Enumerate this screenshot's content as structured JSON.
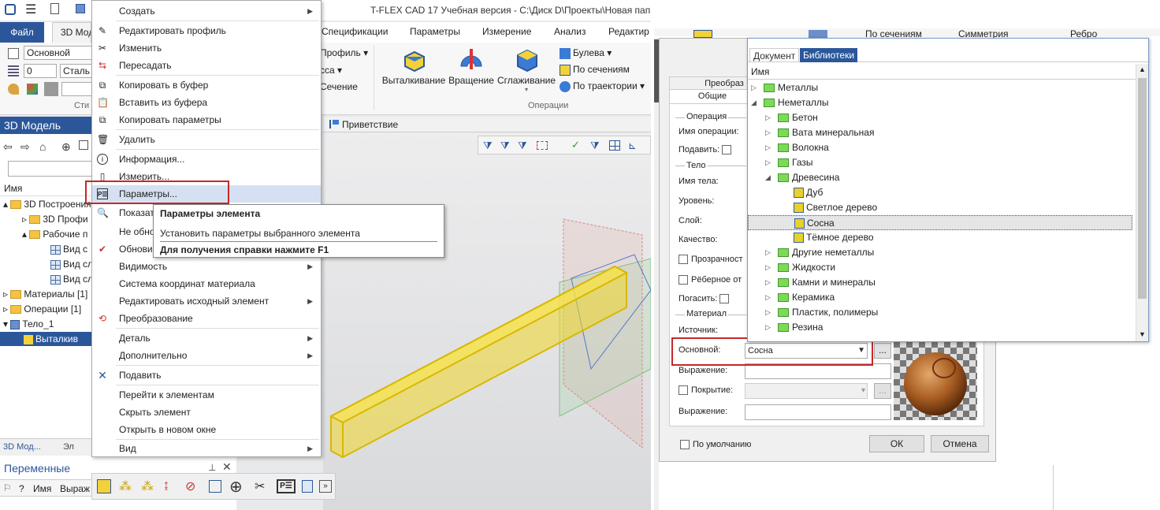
{
  "app": {
    "title": "T-FLEX CAD 17 Учебная версия - C:\\Диск D\\Проекты\\Новая папк",
    "tabs": [
      "Файл",
      "3D Модель",
      "Спецификации",
      "Параметры",
      "Измерение",
      "Анализ",
      "Редактир"
    ],
    "ribbon": {
      "style_combo": "Основной",
      "layer_combo": "0",
      "material_combo": "Сталь",
      "style_group": "Сти",
      "left_buttons": [
        "Профиль",
        "сса",
        "Сечение"
      ],
      "ops": [
        "Выталкивание",
        "Вращение",
        "Сглаживание"
      ],
      "ops_group": "Операции",
      "small_ops": [
        "Булева",
        "По сечениям",
        "По траектории"
      ]
    },
    "panel_title": "3D Модель",
    "tree_header": "Имя",
    "tree": [
      "3D Построения",
      "3D Профи",
      "Рабочие п",
      "Вид с",
      "Вид сл",
      "Вид сл",
      "Материалы [1]",
      "Операции [1]",
      "Тело_1",
      "Выталкив"
    ],
    "viewport_tab": "Приветствие",
    "bottom_tabs": [
      "3D Мод...",
      "Эл"
    ],
    "variables": {
      "title": "Переменные",
      "cols": [
        "?",
        "Имя",
        "Выраж"
      ]
    }
  },
  "context_menu": {
    "items": [
      "Создать",
      "Редактировать профиль",
      "Изменить",
      "Пересадать",
      "Копировать в буфер",
      "Вставить из буфера",
      "Копировать параметры",
      "Удалить",
      "Информация...",
      "Измерить...",
      "Параметры...",
      "Показать",
      "Не обно",
      "Обнови",
      "Видимость",
      "Система координат материала",
      "Редактировать исходный элемент",
      "Преобразование",
      "Деталь",
      "Дополнительно",
      "Подавить",
      "Перейти к элементам",
      "Скрыть элемент",
      "Открыть в новом окне",
      "Вид"
    ]
  },
  "tooltip": {
    "title": "Параметры элемента",
    "line1": "Установить параметры выбранного элемента",
    "line2": "Для получения справки нажмите F1"
  },
  "top_strip": {
    "items": [
      "По сечениям",
      "Симметрия",
      "Ребро"
    ]
  },
  "dialog": {
    "tab_partial": "Преобраз",
    "tab_general": "Общие",
    "section_operation": "Операция",
    "op_name_label": "Имя операции:",
    "suppress_label": "Подавить:",
    "section_body": "Тело",
    "body_name_label": "Имя тела:",
    "level_label": "Уровень:",
    "layer_label": "Слой:",
    "quality_label": "Качество:",
    "transparency_label": "Прозрачност",
    "rib_label": "Рёберное от",
    "hide_label": "Погасить:",
    "section_material": "Материал",
    "source_label": "Источник:",
    "main_label": "Основной:",
    "main_value": "Сосна",
    "expr_label": "Выражение:",
    "coating_label": "Покрытие:",
    "expr2_label": "Выражение:",
    "default_label": "По умолчанию",
    "ok": "ОК",
    "cancel": "Отмена",
    "ellipsis": "..."
  },
  "library": {
    "tabs": [
      "Документ",
      "Библиотеки"
    ],
    "header": "Имя",
    "rows": [
      "Металлы",
      "Неметаллы",
      "Бетон",
      "Вата минеральная",
      "Волокна",
      "Газы",
      "Древесина",
      "Дуб",
      "Светлое дерево",
      "Сосна",
      "Тёмное дерево",
      "Другие неметаллы",
      "Жидкости",
      "Камни и минералы",
      "Керамика",
      "Пластик, полимеры",
      "Резина"
    ]
  }
}
